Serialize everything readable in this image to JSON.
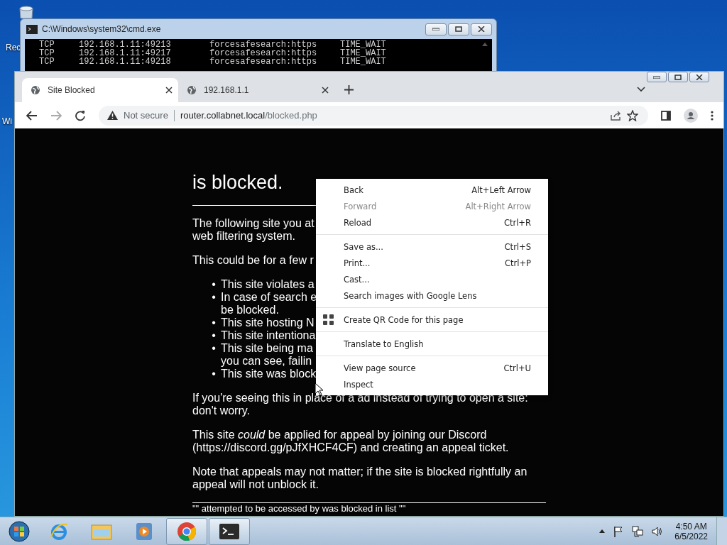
{
  "desktop": {
    "icon_labels": [
      "Rec",
      "Wi"
    ]
  },
  "console": {
    "title": "C:\\Windows\\system32\\cmd.exe",
    "rows": [
      [
        "TCP",
        "192.168.1.11:49213",
        "forcesafesearch:https",
        "TIME_WAIT"
      ],
      [
        "TCP",
        "192.168.1.11:49217",
        "forcesafesearch:https",
        "TIME_WAIT"
      ],
      [
        "TCP",
        "192.168.1.11:49218",
        "forcesafesearch:https",
        "TIME_WAIT"
      ]
    ]
  },
  "browser": {
    "tabs": [
      {
        "label": "Site Blocked",
        "selected": true
      },
      {
        "label": "192.168.1.1",
        "selected": false
      }
    ],
    "security": "Not secure",
    "url_host": "router.collabnet.local",
    "url_path": "/blocked.php"
  },
  "page": {
    "heading": "is blocked.",
    "blocks": [
      {
        "kind": "para",
        "lines": [
          "The following site you at",
          "web filtering system."
        ]
      },
      {
        "kind": "para",
        "lines": [
          "This could be for a few r"
        ]
      },
      {
        "kind": "list",
        "marker": "•",
        "items": [
          [
            "This site violates a"
          ],
          [
            "In case of search e",
            "be blocked."
          ],
          [
            "This site hosting N"
          ],
          [
            "This site intentiona"
          ],
          [
            "This site being ma",
            "you can see, failin"
          ],
          [
            "This site was block"
          ]
        ]
      },
      {
        "kind": "para",
        "lines": [
          "If you're seeing this in place of a ad instead of trying to open a site:",
          "don't worry."
        ]
      },
      {
        "kind": "para",
        "lines": [
          "This site *could* be applied for appeal by joining our Discord",
          "(https://discord.gg/pJfXHCF4CF) and creating an appeal ticket."
        ]
      },
      {
        "kind": "para",
        "lines": [
          "Note that appeals may not matter; if the site is blocked rightfully an",
          "appeal will not unblock it."
        ]
      },
      {
        "kind": "rule"
      },
      {
        "kind": "footer",
        "lines": [
          "\"\" attempted to be accessed by was blocked in list \"\""
        ]
      }
    ]
  },
  "context_menu": [
    {
      "kind": "item",
      "label": "Back",
      "shortcut": "Alt+Left Arrow",
      "disabled": false
    },
    {
      "kind": "item",
      "label": "Forward",
      "shortcut": "Alt+Right Arrow",
      "disabled": true
    },
    {
      "kind": "item",
      "label": "Reload",
      "shortcut": "Ctrl+R",
      "disabled": false
    },
    {
      "kind": "separator"
    },
    {
      "kind": "item",
      "label": "Save as...",
      "shortcut": "Ctrl+S",
      "disabled": false
    },
    {
      "kind": "item",
      "label": "Print...",
      "shortcut": "Ctrl+P",
      "disabled": false
    },
    {
      "kind": "item",
      "label": "Cast...",
      "disabled": false
    },
    {
      "kind": "item",
      "label": "Search images with Google Lens",
      "disabled": false
    },
    {
      "kind": "separator"
    },
    {
      "kind": "qr",
      "label": "Create QR Code for this page",
      "disabled": false
    },
    {
      "kind": "separator"
    },
    {
      "kind": "item",
      "label": "Translate to English",
      "disabled": false
    },
    {
      "kind": "separator"
    },
    {
      "kind": "item",
      "label": "View page source",
      "shortcut": "Ctrl+U",
      "disabled": false
    },
    {
      "kind": "item",
      "label": "Inspect",
      "disabled": false
    }
  ],
  "taskbar": {
    "apps": [
      {
        "kind": "ie",
        "selected": false
      },
      {
        "kind": "explorer",
        "selected": false
      },
      {
        "kind": "media",
        "selected": false
      },
      {
        "kind": "chrome",
        "selected": true
      },
      {
        "kind": "terminal",
        "selected": true
      }
    ],
    "time": "4:50 AM",
    "date": "6/5/2022"
  }
}
